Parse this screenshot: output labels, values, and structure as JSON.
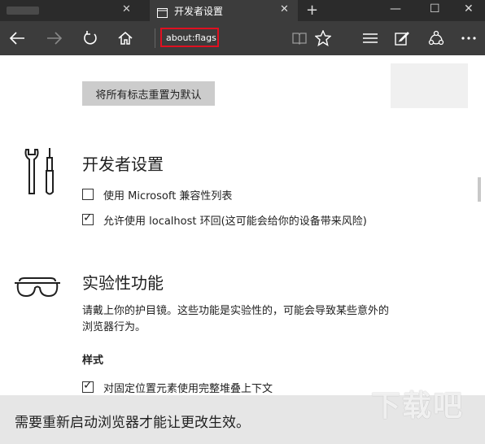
{
  "tabs": {
    "active_title": "开发者设置"
  },
  "address": {
    "url": "about:flags"
  },
  "content": {
    "reset_button": "将所有标志重置为默认",
    "developer": {
      "heading": "开发者设置",
      "options": [
        {
          "label": "使用 Microsoft 兼容性列表",
          "checked": false
        },
        {
          "label": "允许使用 localhost 环回(这可能会给你的设备带来风险)",
          "checked": true
        }
      ]
    },
    "experimental": {
      "heading": "实验性功能",
      "description": "请戴上你的护目镜。这些功能是实验性的，可能会导致某些意外的浏览器行为。",
      "section_label": "样式",
      "options": [
        {
          "label": "对固定位置元素使用完整堆叠上下文",
          "checked": true
        }
      ]
    }
  },
  "notification": {
    "text": "需要重新启动浏览器才能让更改生效。"
  },
  "watermark": {
    "text": "下载吧"
  },
  "icons": [
    "page-icon",
    "close-icon",
    "plus-icon",
    "minimize-icon",
    "maximize-icon",
    "back-icon",
    "forward-icon",
    "refresh-icon",
    "home-icon",
    "reading-view-icon",
    "favorite-star-icon",
    "hub-icon",
    "web-note-icon",
    "share-icon",
    "more-icon",
    "tools-icon",
    "goggles-icon"
  ]
}
